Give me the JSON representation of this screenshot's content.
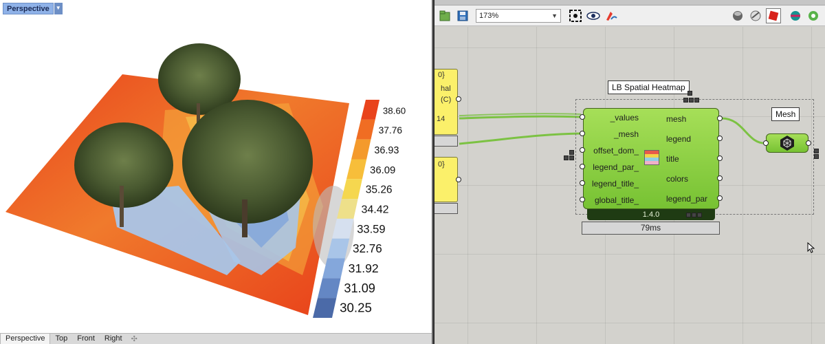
{
  "viewport": {
    "title": "Perspective",
    "tabs": [
      "Perspective",
      "Top",
      "Front",
      "Right"
    ],
    "legend_values": [
      "38.60",
      "37.76",
      "36.93",
      "36.09",
      "35.26",
      "34.42",
      "33.59",
      "32.76",
      "31.92",
      "31.09",
      "30.25"
    ],
    "legend_colors": [
      "#e9431c",
      "#f06d23",
      "#f49a2c",
      "#f7be3a",
      "#f5d74f",
      "#eee08a",
      "#d6e0ef",
      "#a9c5e8",
      "#84a7db",
      "#6487c4",
      "#4b6aa8"
    ]
  },
  "toolbar": {
    "zoom_level": "173%",
    "icons": [
      "open-file-icon",
      "save-icon",
      "zoom-extents-icon",
      "eye-icon",
      "sketch-icon",
      "preview-mode-icon",
      "preview-wire-icon",
      "preview-shaded-icon",
      "preview-selected-icon",
      "preview-all-icon"
    ]
  },
  "canvas": {
    "panel_top": {
      "header": "0}",
      "line1": "hal",
      "line2": "(C)",
      "value": "14"
    },
    "panel_bottom": {
      "header": "0}"
    },
    "heatmap": {
      "name": "LB Spatial Heatmap",
      "inputs": [
        "_values",
        "_mesh",
        "offset_dom_",
        "legend_par_",
        "legend_title_",
        "global_title_"
      ],
      "outputs": [
        "mesh",
        "legend",
        "title",
        "colors",
        "legend_par"
      ],
      "version": "1.4.0",
      "timer": "79ms"
    },
    "mesh_component": {
      "name": "Mesh"
    },
    "accent_wire_color": "#7cc243"
  }
}
